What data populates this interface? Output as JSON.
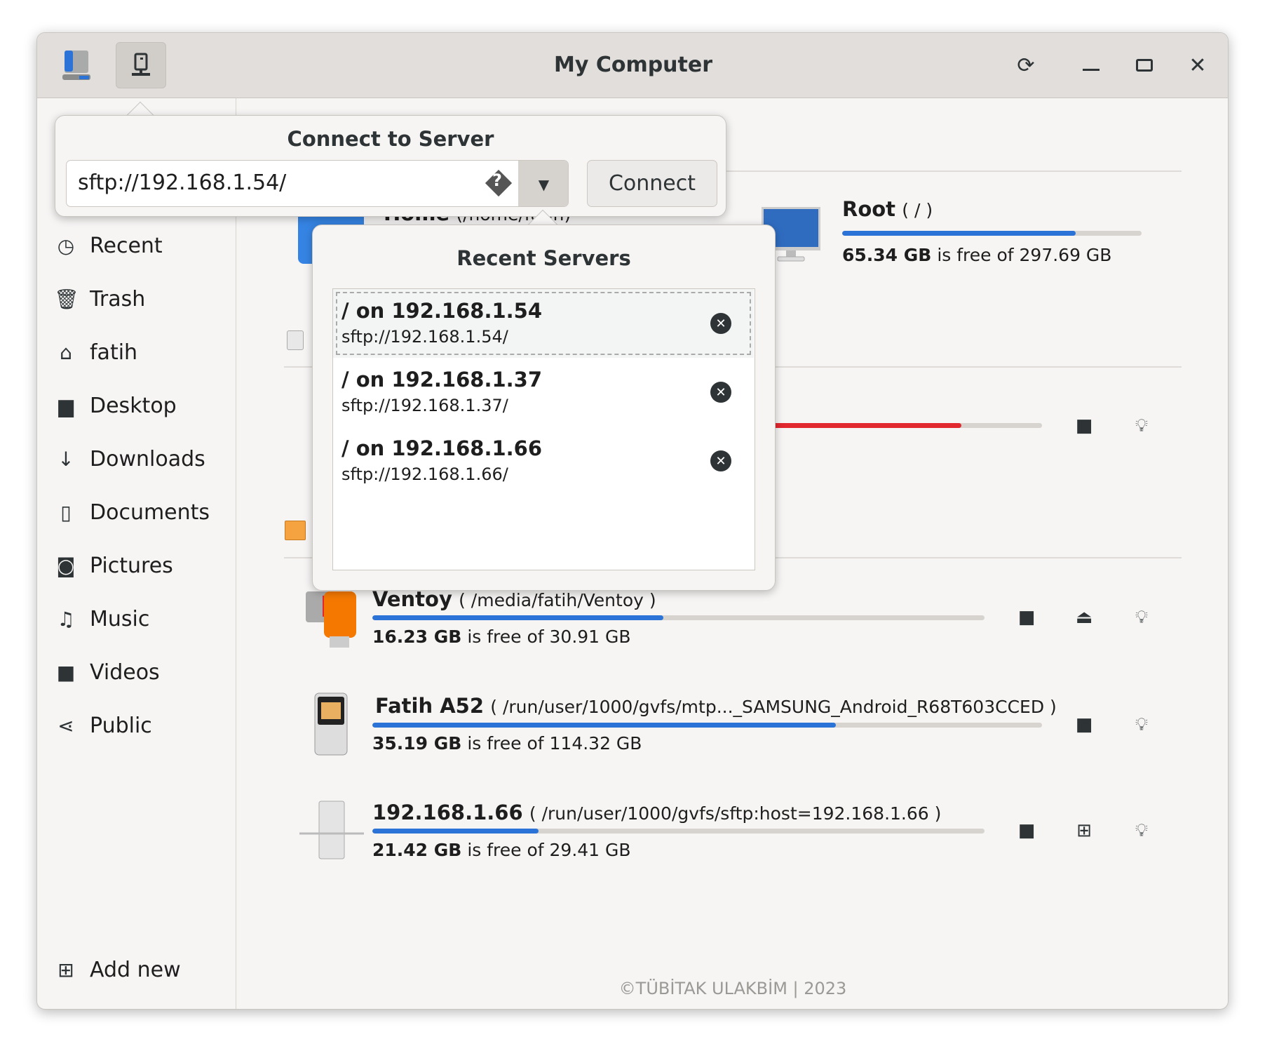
{
  "window": {
    "title": "My Computer"
  },
  "header": {
    "left_buttons": [
      {
        "icon": "drive-icon"
      },
      {
        "icon": "network-server-icon"
      }
    ],
    "right_buttons": [
      {
        "icon": "refresh-icon"
      },
      {
        "icon": "minimize-icon"
      },
      {
        "icon": "maximize-icon"
      },
      {
        "icon": "close-icon"
      }
    ]
  },
  "sidebar": {
    "items": [
      {
        "label": "Recent",
        "icon": "clock-icon",
        "glyph": "◷"
      },
      {
        "label": "Trash",
        "icon": "trash-icon",
        "glyph": "🗑"
      },
      {
        "label": "fatih",
        "icon": "home-icon",
        "glyph": "⌂"
      },
      {
        "label": "Desktop",
        "icon": "folder-icon",
        "glyph": "▆"
      },
      {
        "label": "Downloads",
        "icon": "download-icon",
        "glyph": "↓"
      },
      {
        "label": "Documents",
        "icon": "document-icon",
        "glyph": "▯"
      },
      {
        "label": "Pictures",
        "icon": "camera-icon",
        "glyph": "◙"
      },
      {
        "label": "Music",
        "icon": "music-icon",
        "glyph": "♫"
      },
      {
        "label": "Videos",
        "icon": "video-icon",
        "glyph": "■"
      },
      {
        "label": "Public",
        "icon": "share-icon",
        "glyph": "⋖"
      }
    ],
    "add_new": "Add new"
  },
  "drives": {
    "home": {
      "name": "Home",
      "path": "(/home/fatih)"
    },
    "root": {
      "name": "Root",
      "path": "( / )",
      "free": "65.34 GB",
      "free_suffix": "is free of 297.69 GB",
      "used_fraction": 0.78
    },
    "hidden_disk": {
      "used_fraction": 0.88,
      "color": "#e0282e"
    },
    "ventoy": {
      "name": "Ventoy",
      "path": "( /media/fatih/Ventoy )",
      "free": "16.23 GB",
      "free_suffix": "is free of 30.91 GB",
      "used_fraction": 0.475
    },
    "phone": {
      "name": "Fatih A52",
      "path": "( /run/user/1000/gvfs/mtp..._SAMSUNG_Android_R68T603CCED )",
      "free": "35.19 GB",
      "free_suffix": "is free of 114.32 GB",
      "used_fraction": 0.692
    },
    "sftp": {
      "name": "192.168.1.66",
      "path": "( /run/user/1000/gvfs/sftp:host=192.168.1.66 )",
      "free": "21.42 GB",
      "free_suffix": "is free of 29.41 GB",
      "used_fraction": 0.272
    }
  },
  "connect_popover": {
    "title": "Connect to Server",
    "input_value": "sftp://192.168.1.54/",
    "button": "Connect"
  },
  "recent_servers": {
    "title": "Recent Servers",
    "items": [
      {
        "title": "/ on 192.168.1.54",
        "url": "sftp://192.168.1.54/"
      },
      {
        "title": "/ on 192.168.1.37",
        "url": "sftp://192.168.1.37/"
      },
      {
        "title": "/ on 192.168.1.66",
        "url": "sftp://192.168.1.66/"
      }
    ]
  },
  "footer": "©TÜBİTAK ULAKBİM | 2023",
  "colors": {
    "accent": "#2b73d6",
    "danger": "#e0282e"
  }
}
